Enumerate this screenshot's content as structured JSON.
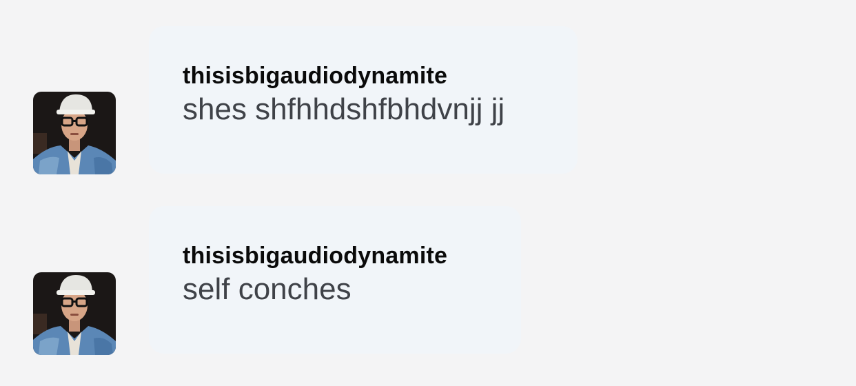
{
  "messages": [
    {
      "username": "thisisbigaudiodynamite",
      "text": "shes shfhhdshfbhdvnjj jj",
      "avatar_icon": "user-photo-avatar"
    },
    {
      "username": "thisisbigaudiodynamite",
      "text": "self conches",
      "avatar_icon": "user-photo-avatar"
    }
  ],
  "colors": {
    "background": "#f4f4f5",
    "bubble": "#f1f5f9",
    "username": "#0a0a0a",
    "text": "#3f4248"
  }
}
